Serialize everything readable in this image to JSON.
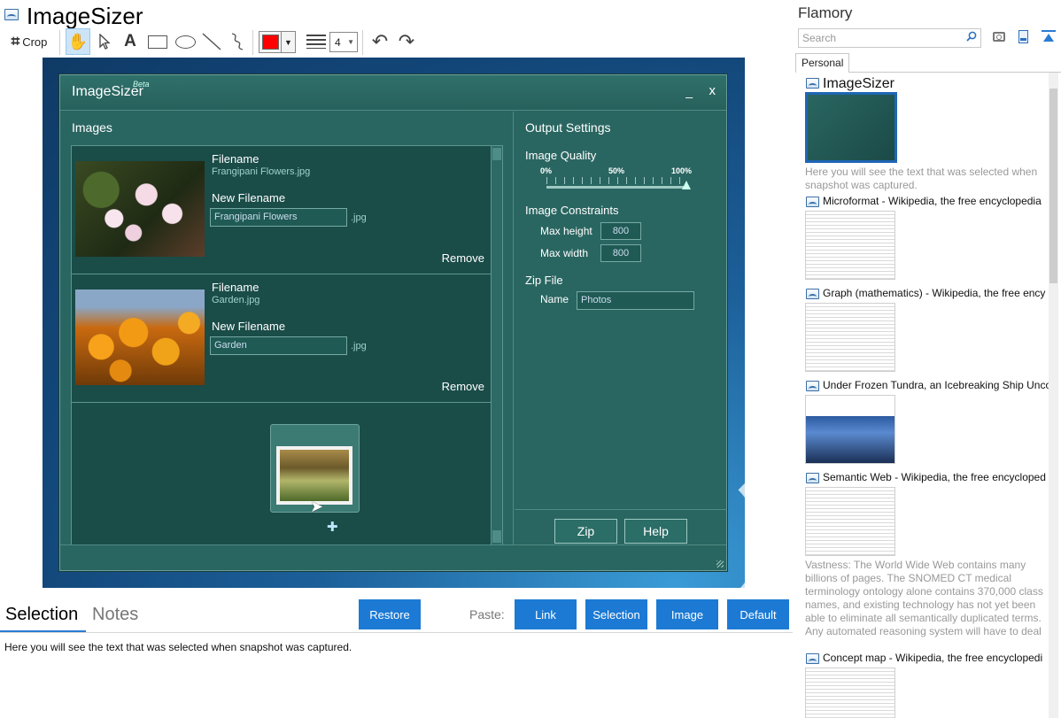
{
  "app": {
    "title": "ImageSizer"
  },
  "toolbar": {
    "crop_label": "Crop",
    "line_width": "4",
    "selected_color": "#ff0000"
  },
  "snapshot_window": {
    "title": "ImageSizer",
    "beta": "Beta",
    "minimize": "_",
    "close": "x",
    "images_heading": "Images",
    "images": [
      {
        "filename_label": "Filename",
        "filename": "Frangipani Flowers.jpg",
        "new_filename_label": "New Filename",
        "new_filename": "Frangipani Flowers",
        "ext": ".jpg",
        "remove": "Remove"
      },
      {
        "filename_label": "Filename",
        "filename": "Garden.jpg",
        "new_filename_label": "New Filename",
        "new_filename": "Garden",
        "ext": ".jpg",
        "remove": "Remove"
      }
    ],
    "settings": {
      "heading": "Output Settings",
      "quality_label": "Image Quality",
      "quality_ticks": [
        "0%",
        "50%",
        "100%"
      ],
      "quality_value": 1.0,
      "constraints_label": "Image Constraints",
      "max_height_label": "Max height",
      "max_height": "800",
      "max_width_label": "Max width",
      "max_width": "800",
      "zip_label": "Zip File",
      "zip_name_label": "Name",
      "zip_name": "Photos",
      "zip_button": "Zip",
      "help_button": "Help"
    }
  },
  "bottom": {
    "tab_selection": "Selection",
    "tab_notes": "Notes",
    "restore": "Restore",
    "paste_label": "Paste:",
    "paste_link": "Link",
    "paste_selection": "Selection",
    "paste_image": "Image",
    "paste_default": "Default",
    "selection_text": "Here you will see the text that was selected when snapshot was captured."
  },
  "sidebar": {
    "title": "Flamory",
    "search_placeholder": "Search",
    "tab_personal": "Personal",
    "snapshots": [
      {
        "title": "ImageSizer",
        "desc": "Here you will see the text that was selected when snapshot was captured."
      },
      {
        "title": "Microformat - Wikipedia, the free encyclopedia",
        "desc": ""
      },
      {
        "title": "Graph (mathematics) - Wikipedia, the free ency",
        "desc": ""
      },
      {
        "title": "Under Frozen Tundra, an Icebreaking Ship Unco",
        "desc": ""
      },
      {
        "title": "Semantic Web - Wikipedia, the free encycloped",
        "desc": "Vastness: The World Wide Web contains many billions of pages. The SNOMED CT medical terminology ontology alone contains 370,000 class names, and existing technology has not yet been able to eliminate all semantically duplicated terms. Any automated reasoning system will have to deal with truly huge inputs."
      },
      {
        "title": "Concept map - Wikipedia, the free encyclopedi",
        "desc": ""
      }
    ]
  }
}
